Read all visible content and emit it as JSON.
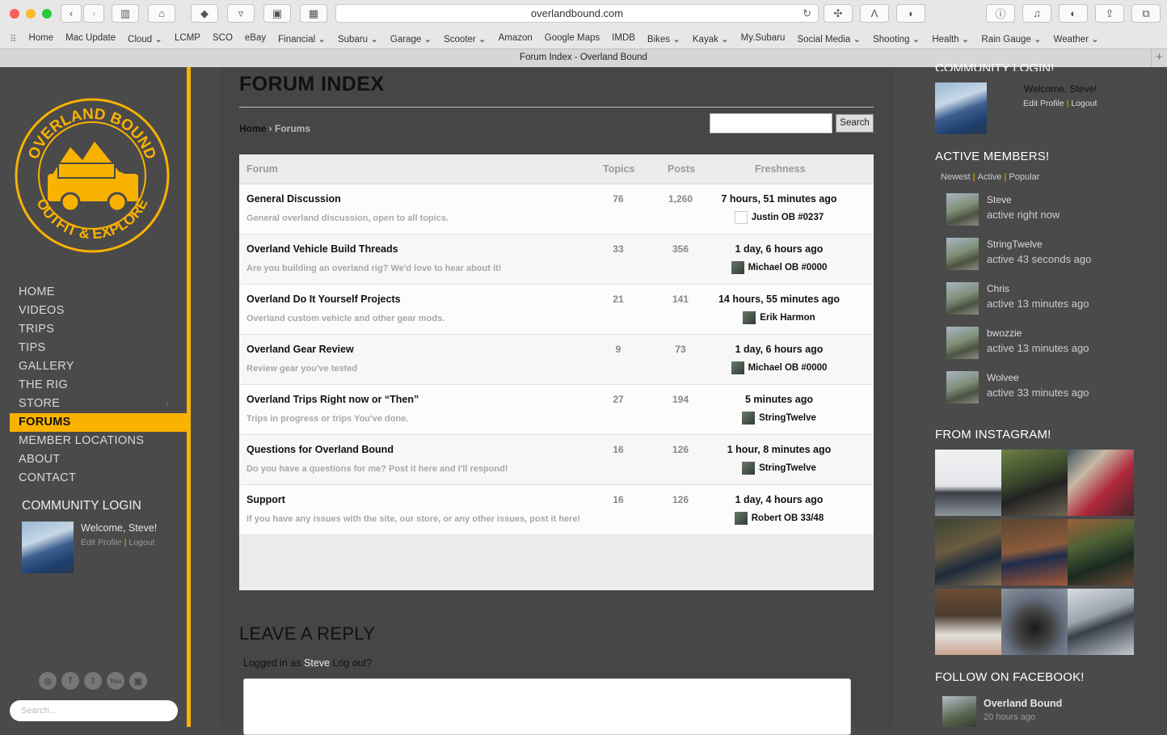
{
  "browser": {
    "url": "overlandbound.com",
    "tab_title": "Forum Index - Overland Bound",
    "bookmarks": [
      "Home",
      "Mac Update",
      "Cloud ⌄",
      "LCMP",
      "SCO",
      "eBay",
      "Financial ⌄",
      "Subaru ⌄",
      "Garage ⌄",
      "Scooter ⌄",
      "Amazon",
      "Google Maps",
      "IMDB",
      "Bikes ⌄",
      "Kayak ⌄",
      "My.Subaru",
      "Social Media ⌄",
      "Shooting ⌄",
      "Health ⌄",
      "Rain Gauge ⌄",
      "Weather ⌄"
    ]
  },
  "logo": {
    "top_text": "OVERLAND BOUND",
    "bottom_text": "OUTFIT & EXPLORE",
    "color": "#f9b200"
  },
  "nav": {
    "items": [
      "HOME",
      "VIDEOS",
      "TRIPS",
      "TIPS",
      "GALLERY",
      "THE RIG",
      "STORE",
      "FORUMS",
      "MEMBER LOCATIONS",
      "ABOUT",
      "CONTACT"
    ],
    "store_caret": "›",
    "active": "FORUMS"
  },
  "sidebar_login": {
    "title": "COMMUNITY LOGIN",
    "welcome": "Welcome, Steve!",
    "edit_profile": "Edit Profile",
    "sep": "|",
    "logout": "Logout"
  },
  "social": [
    "rss-icon",
    "facebook-icon",
    "twitter-icon",
    "youtube-icon",
    "instagram-icon"
  ],
  "social_glyphs": {
    "rss": "◎",
    "facebook": "f",
    "twitter": "t",
    "youtube": "You",
    "instagram": "▣"
  },
  "sidebar_search": {
    "placeholder": "Search..."
  },
  "page": {
    "title": "FORUM INDEX",
    "breadcrumb_home": "Home",
    "breadcrumb_sep": " › ",
    "breadcrumb_current": "Forums",
    "search_button": "Search"
  },
  "forum_table": {
    "headers": {
      "forum": "Forum",
      "topics": "Topics",
      "posts": "Posts",
      "freshness": "Freshness"
    },
    "rows": [
      {
        "title": "General Discussion",
        "desc": "General overland discussion, open to all topics.",
        "topics": "76",
        "posts": "1,260",
        "fresh": "7 hours, 51 minutes ago",
        "author": "Justin OB #0237"
      },
      {
        "title": "Overland Vehicle Build Threads",
        "desc": "Are you building an overland rig? We'd love to hear about it!",
        "topics": "33",
        "posts": "356",
        "fresh": "1 day, 6 hours ago",
        "author": "Michael OB #0000"
      },
      {
        "title": "Overland Do It Yourself Projects",
        "desc": "Overland custom vehicle and other gear mods.",
        "topics": "21",
        "posts": "141",
        "fresh": "14 hours, 55 minutes ago",
        "author": "Erik Harmon"
      },
      {
        "title": "Overland Gear Review",
        "desc": "Review gear you've tested",
        "topics": "9",
        "posts": "73",
        "fresh": "1 day, 6 hours ago",
        "author": "Michael OB #0000"
      },
      {
        "title": "Overland Trips Right now or “Then”",
        "desc": "Trips in progress or trips You've done.",
        "topics": "27",
        "posts": "194",
        "fresh": "5 minutes ago",
        "author": "StringTwelve"
      },
      {
        "title": "Questions for Overland Bound",
        "desc": "Do you have a questions for me? Post it here and I'll respond!",
        "topics": "16",
        "posts": "126",
        "fresh": "1 hour, 8 minutes ago",
        "author": "StringTwelve"
      },
      {
        "title": "Support",
        "desc": "If you have any issues with the site, our store, or any other issues, post it here!",
        "topics": "16",
        "posts": "126",
        "fresh": "1 day, 4 hours ago",
        "author": "Robert OB 33/48"
      }
    ]
  },
  "reply": {
    "title": "LEAVE A REPLY",
    "logged_in_as": "Logged in as",
    "user": "Steve",
    "logout": "Log out?"
  },
  "right_sidebar": {
    "login_title_cut": "COMMUNITY LOGIN!",
    "welcome": "Welcome, Steve!",
    "edit_profile": "Edit Profile",
    "sep": "|",
    "logout": "Logout",
    "active_title": "ACTIVE MEMBERS!",
    "tabs": [
      "Newest",
      "Active",
      "Popular"
    ],
    "members": [
      {
        "name": "Steve",
        "status": "active right now"
      },
      {
        "name": "StringTwelve",
        "status": "active 43 seconds ago"
      },
      {
        "name": "Chris",
        "status": "active 13 minutes ago"
      },
      {
        "name": "bwozzie",
        "status": "active 13 minutes ago"
      },
      {
        "name": "Wolvee",
        "status": "active 33 minutes ago"
      }
    ],
    "instagram_title": "FROM INSTAGRAM!",
    "facebook_title": "FOLLOW ON FACEBOOK!",
    "fb_page": "Overland Bound",
    "fb_time": "20 hours ago"
  }
}
